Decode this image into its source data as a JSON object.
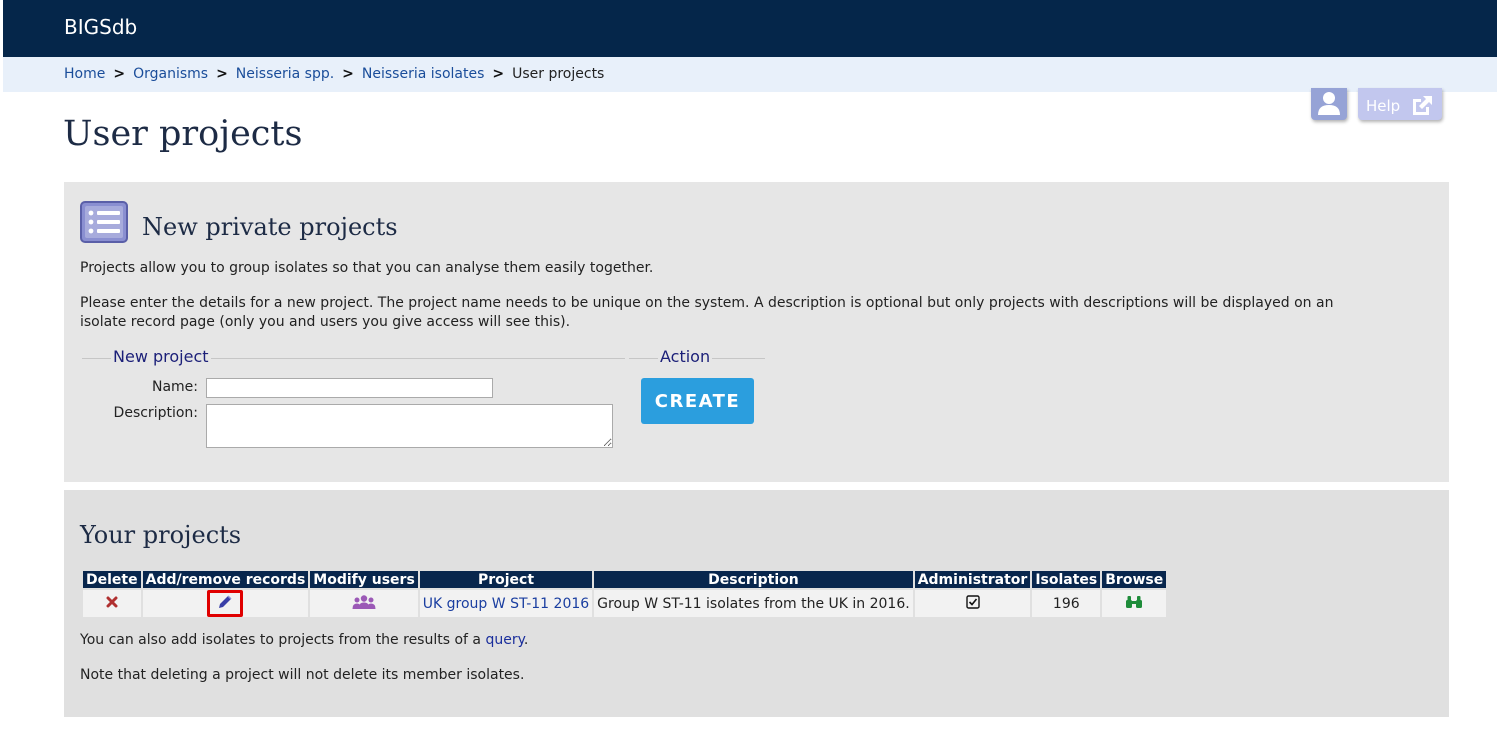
{
  "header": {
    "brand": "BIGSdb"
  },
  "breadcrumb": {
    "items": [
      "Home",
      "Organisms",
      "Neisseria spp.",
      "Neisseria isolates"
    ],
    "current": "User projects",
    "separator": ">"
  },
  "toolbar": {
    "help_label": "Help"
  },
  "page": {
    "title": "User projects"
  },
  "new_projects": {
    "heading": "New private projects",
    "intro": "Projects allow you to group isolates so that you can analyse them easily together.",
    "instructions": "Please enter the details for a new project. The project name needs to be unique on the system. A description is optional but only projects with descriptions will be displayed on an isolate record page (only you and users you give access will see this).",
    "form_legend": "New project",
    "action_legend": "Action",
    "name_label": "Name:",
    "name_value": "",
    "description_label": "Description:",
    "description_value": "",
    "create_label": "CREATE"
  },
  "your_projects": {
    "heading": "Your projects",
    "columns": [
      "Delete",
      "Add/remove records",
      "Modify users",
      "Project",
      "Description",
      "Administrator",
      "Isolates",
      "Browse"
    ],
    "rows": [
      {
        "project": "UK group W ST-11 2016",
        "description": "Group W ST-11 isolates from the UK in 2016.",
        "isolates": "196",
        "delete_icon": "cross-icon",
        "edit_icon": "pencil-icon",
        "users_icon": "users-icon",
        "admin_icon": "checkbox-checked-icon",
        "browse_icon": "binoculars-icon"
      }
    ],
    "note_prefix": "You can also add isolates to projects from the results of a",
    "note_link": "query",
    "note_suffix": ".",
    "delete_note": "Note that deleting a project will not delete its member isolates."
  },
  "colors": {
    "header_bg": "#05264a",
    "breadcrumb_bg": "#e8f0fa",
    "accent_button": "#2b9ede",
    "highlight": "#e00000",
    "link": "#1a4d9a"
  }
}
